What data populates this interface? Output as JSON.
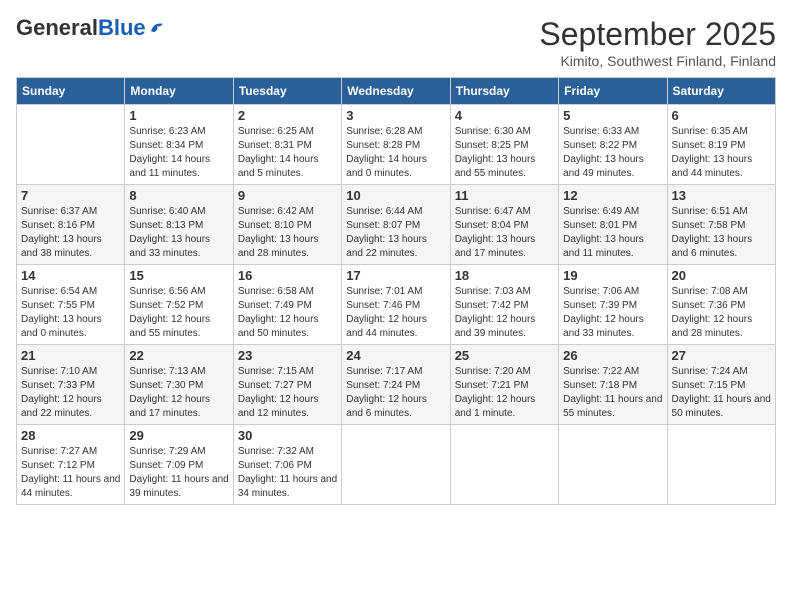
{
  "header": {
    "logo_general": "General",
    "logo_blue": "Blue",
    "month_title": "September 2025",
    "location": "Kimito, Southwest Finland, Finland"
  },
  "weekdays": [
    "Sunday",
    "Monday",
    "Tuesday",
    "Wednesday",
    "Thursday",
    "Friday",
    "Saturday"
  ],
  "weeks": [
    [
      {
        "day": "",
        "sunrise": "",
        "sunset": "",
        "daylight": ""
      },
      {
        "day": "1",
        "sunrise": "Sunrise: 6:23 AM",
        "sunset": "Sunset: 8:34 PM",
        "daylight": "Daylight: 14 hours and 11 minutes."
      },
      {
        "day": "2",
        "sunrise": "Sunrise: 6:25 AM",
        "sunset": "Sunset: 8:31 PM",
        "daylight": "Daylight: 14 hours and 5 minutes."
      },
      {
        "day": "3",
        "sunrise": "Sunrise: 6:28 AM",
        "sunset": "Sunset: 8:28 PM",
        "daylight": "Daylight: 14 hours and 0 minutes."
      },
      {
        "day": "4",
        "sunrise": "Sunrise: 6:30 AM",
        "sunset": "Sunset: 8:25 PM",
        "daylight": "Daylight: 13 hours and 55 minutes."
      },
      {
        "day": "5",
        "sunrise": "Sunrise: 6:33 AM",
        "sunset": "Sunset: 8:22 PM",
        "daylight": "Daylight: 13 hours and 49 minutes."
      },
      {
        "day": "6",
        "sunrise": "Sunrise: 6:35 AM",
        "sunset": "Sunset: 8:19 PM",
        "daylight": "Daylight: 13 hours and 44 minutes."
      }
    ],
    [
      {
        "day": "7",
        "sunrise": "Sunrise: 6:37 AM",
        "sunset": "Sunset: 8:16 PM",
        "daylight": "Daylight: 13 hours and 38 minutes."
      },
      {
        "day": "8",
        "sunrise": "Sunrise: 6:40 AM",
        "sunset": "Sunset: 8:13 PM",
        "daylight": "Daylight: 13 hours and 33 minutes."
      },
      {
        "day": "9",
        "sunrise": "Sunrise: 6:42 AM",
        "sunset": "Sunset: 8:10 PM",
        "daylight": "Daylight: 13 hours and 28 minutes."
      },
      {
        "day": "10",
        "sunrise": "Sunrise: 6:44 AM",
        "sunset": "Sunset: 8:07 PM",
        "daylight": "Daylight: 13 hours and 22 minutes."
      },
      {
        "day": "11",
        "sunrise": "Sunrise: 6:47 AM",
        "sunset": "Sunset: 8:04 PM",
        "daylight": "Daylight: 13 hours and 17 minutes."
      },
      {
        "day": "12",
        "sunrise": "Sunrise: 6:49 AM",
        "sunset": "Sunset: 8:01 PM",
        "daylight": "Daylight: 13 hours and 11 minutes."
      },
      {
        "day": "13",
        "sunrise": "Sunrise: 6:51 AM",
        "sunset": "Sunset: 7:58 PM",
        "daylight": "Daylight: 13 hours and 6 minutes."
      }
    ],
    [
      {
        "day": "14",
        "sunrise": "Sunrise: 6:54 AM",
        "sunset": "Sunset: 7:55 PM",
        "daylight": "Daylight: 13 hours and 0 minutes."
      },
      {
        "day": "15",
        "sunrise": "Sunrise: 6:56 AM",
        "sunset": "Sunset: 7:52 PM",
        "daylight": "Daylight: 12 hours and 55 minutes."
      },
      {
        "day": "16",
        "sunrise": "Sunrise: 6:58 AM",
        "sunset": "Sunset: 7:49 PM",
        "daylight": "Daylight: 12 hours and 50 minutes."
      },
      {
        "day": "17",
        "sunrise": "Sunrise: 7:01 AM",
        "sunset": "Sunset: 7:46 PM",
        "daylight": "Daylight: 12 hours and 44 minutes."
      },
      {
        "day": "18",
        "sunrise": "Sunrise: 7:03 AM",
        "sunset": "Sunset: 7:42 PM",
        "daylight": "Daylight: 12 hours and 39 minutes."
      },
      {
        "day": "19",
        "sunrise": "Sunrise: 7:06 AM",
        "sunset": "Sunset: 7:39 PM",
        "daylight": "Daylight: 12 hours and 33 minutes."
      },
      {
        "day": "20",
        "sunrise": "Sunrise: 7:08 AM",
        "sunset": "Sunset: 7:36 PM",
        "daylight": "Daylight: 12 hours and 28 minutes."
      }
    ],
    [
      {
        "day": "21",
        "sunrise": "Sunrise: 7:10 AM",
        "sunset": "Sunset: 7:33 PM",
        "daylight": "Daylight: 12 hours and 22 minutes."
      },
      {
        "day": "22",
        "sunrise": "Sunrise: 7:13 AM",
        "sunset": "Sunset: 7:30 PM",
        "daylight": "Daylight: 12 hours and 17 minutes."
      },
      {
        "day": "23",
        "sunrise": "Sunrise: 7:15 AM",
        "sunset": "Sunset: 7:27 PM",
        "daylight": "Daylight: 12 hours and 12 minutes."
      },
      {
        "day": "24",
        "sunrise": "Sunrise: 7:17 AM",
        "sunset": "Sunset: 7:24 PM",
        "daylight": "Daylight: 12 hours and 6 minutes."
      },
      {
        "day": "25",
        "sunrise": "Sunrise: 7:20 AM",
        "sunset": "Sunset: 7:21 PM",
        "daylight": "Daylight: 12 hours and 1 minute."
      },
      {
        "day": "26",
        "sunrise": "Sunrise: 7:22 AM",
        "sunset": "Sunset: 7:18 PM",
        "daylight": "Daylight: 11 hours and 55 minutes."
      },
      {
        "day": "27",
        "sunrise": "Sunrise: 7:24 AM",
        "sunset": "Sunset: 7:15 PM",
        "daylight": "Daylight: 11 hours and 50 minutes."
      }
    ],
    [
      {
        "day": "28",
        "sunrise": "Sunrise: 7:27 AM",
        "sunset": "Sunset: 7:12 PM",
        "daylight": "Daylight: 11 hours and 44 minutes."
      },
      {
        "day": "29",
        "sunrise": "Sunrise: 7:29 AM",
        "sunset": "Sunset: 7:09 PM",
        "daylight": "Daylight: 11 hours and 39 minutes."
      },
      {
        "day": "30",
        "sunrise": "Sunrise: 7:32 AM",
        "sunset": "Sunset: 7:06 PM",
        "daylight": "Daylight: 11 hours and 34 minutes."
      },
      {
        "day": "",
        "sunrise": "",
        "sunset": "",
        "daylight": ""
      },
      {
        "day": "",
        "sunrise": "",
        "sunset": "",
        "daylight": ""
      },
      {
        "day": "",
        "sunrise": "",
        "sunset": "",
        "daylight": ""
      },
      {
        "day": "",
        "sunrise": "",
        "sunset": "",
        "daylight": ""
      }
    ]
  ]
}
